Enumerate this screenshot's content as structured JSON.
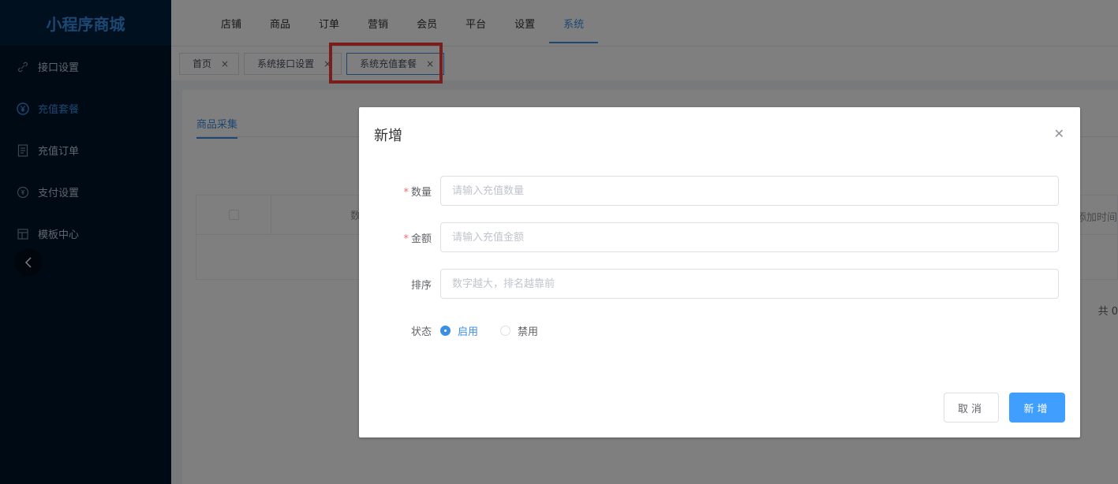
{
  "sidebar": {
    "brand": "小程序商城",
    "items": [
      {
        "label": "接口设置",
        "icon": "link-icon"
      },
      {
        "label": "充值套餐",
        "icon": "yuan-circle-icon",
        "active": true
      },
      {
        "label": "充值订单",
        "icon": "document-icon"
      },
      {
        "label": "支付设置",
        "icon": "payment-icon"
      },
      {
        "label": "模板中心",
        "icon": "template-icon"
      }
    ]
  },
  "topnav": {
    "items": [
      "店铺",
      "商品",
      "订单",
      "营销",
      "会员",
      "平台",
      "设置",
      "系统"
    ],
    "active_index": 7
  },
  "tabs": [
    {
      "label": "首页"
    },
    {
      "label": "系统接口设置"
    },
    {
      "label": "系统充值套餐",
      "active": true
    }
  ],
  "content": {
    "subtab": "商品采集",
    "table": {
      "col_partial": "数",
      "col_right_partial": "添加时间"
    },
    "total_partial": "共 0"
  },
  "dialog": {
    "title": "新增",
    "fields": [
      {
        "label": "数量",
        "required": true,
        "placeholder": "请输入充值数量",
        "value": ""
      },
      {
        "label": "金额",
        "required": true,
        "placeholder": "请输入充值金额",
        "value": ""
      },
      {
        "label": "排序",
        "required": false,
        "placeholder": "数字越大，排名越靠前",
        "value": ""
      }
    ],
    "status": {
      "label": "状态",
      "options": [
        "启用",
        "禁用"
      ],
      "selected": "启用"
    },
    "cancel_label": "取消",
    "ok_label": "新增"
  },
  "colors": {
    "accent": "#409eff",
    "sidebar_bg": "#001529",
    "highlight": "#f53b3b",
    "required": "#f56c6c"
  }
}
